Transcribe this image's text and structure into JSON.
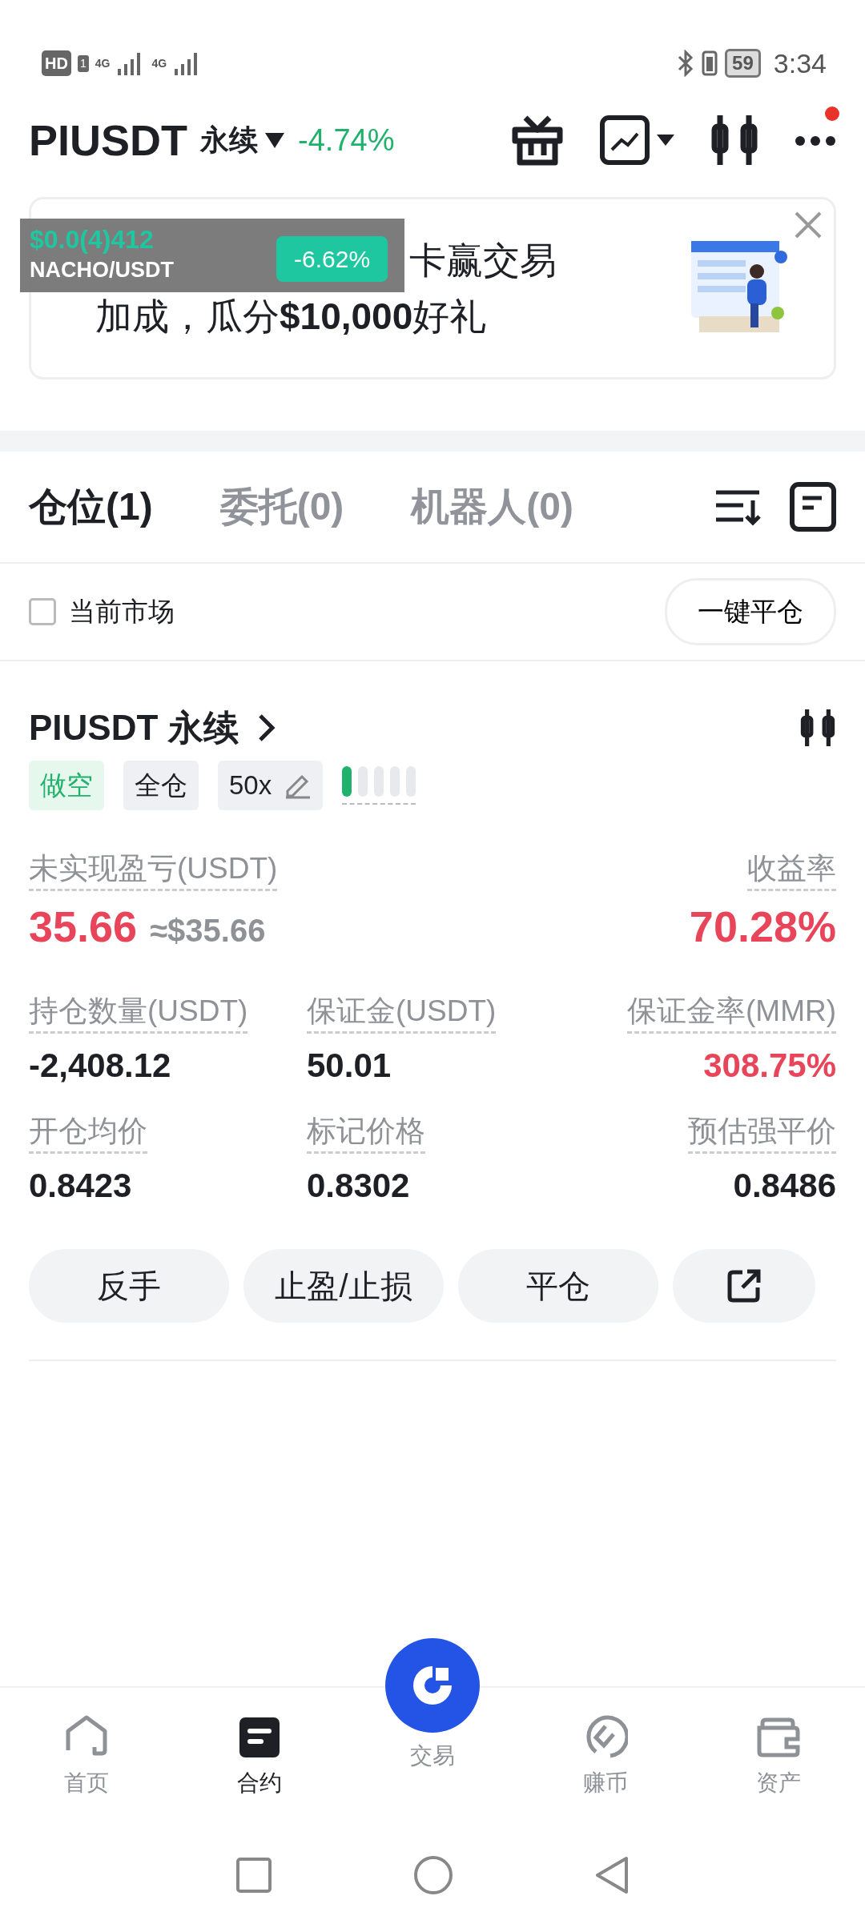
{
  "status_bar": {
    "hd": "HD",
    "sim": "1",
    "network_1": "4G",
    "network_2": "4G",
    "battery": "59",
    "time": "3:34"
  },
  "header": {
    "symbol": "PIUSDT",
    "type": "永续",
    "change": "-4.74%",
    "notification_dot": true
  },
  "banner": {
    "text_line_1": "卡赢交易",
    "text_line_2": "加成，瓜分**$10,000**好礼"
  },
  "price_widget": {
    "price": "$0.0(4)412",
    "pair": "NACHO/USDT",
    "change": "-6.62%"
  },
  "tabs": [
    {
      "label": "仓位(1)",
      "selected": true
    },
    {
      "label": "委托(0)",
      "selected": false
    },
    {
      "label": "机器人(0)",
      "selected": false
    }
  ],
  "filter": {
    "label": "当前市场",
    "checked": false
  },
  "close_all_button": "一键平仓",
  "position": {
    "title": "PIUSDT 永续",
    "tags": [
      {
        "kind": "side",
        "label": "做空"
      },
      {
        "kind": "margin",
        "label": "全仓"
      },
      {
        "kind": "leverage",
        "label": "50x"
      }
    ],
    "pnl_label": "未实现盈亏(USDT)",
    "pnl": "35.66",
    "pnl_usd": "≈$35.66",
    "roe_label": "收益率",
    "roe": "70.28%",
    "stats": [
      {
        "label": "持仓数量(USDT)",
        "value": "-2,408.12",
        "highlight": false
      },
      {
        "label": "保证金(USDT)",
        "value": "50.01",
        "highlight": false
      },
      {
        "label": "保证金率(MMR)",
        "value": "308.75%",
        "highlight": true
      },
      {
        "label": "开仓均价",
        "value": "0.8423",
        "highlight": false
      },
      {
        "label": "标记价格",
        "value": "0.8302",
        "highlight": false
      },
      {
        "label": "预估强平价",
        "value": "0.8486",
        "highlight": false
      }
    ],
    "actions": [
      "反手",
      "止盈/止损",
      "平仓"
    ]
  },
  "bottom_nav": [
    {
      "kind": "home",
      "label": "首页",
      "selected": false
    },
    {
      "kind": "contract",
      "label": "合约",
      "selected": true
    },
    {
      "kind": "trade",
      "label": "交易",
      "selected": false
    },
    {
      "kind": "earn",
      "label": "赚币",
      "selected": false
    },
    {
      "kind": "assets",
      "label": "资产",
      "selected": false
    }
  ]
}
